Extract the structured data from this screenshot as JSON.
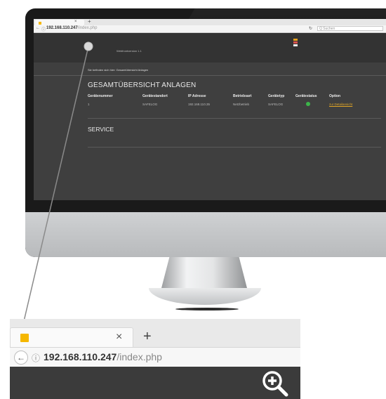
{
  "browser": {
    "url_host": "192.168.110.247",
    "url_path": "/index.php",
    "search_placeholder": "Q  Suchen",
    "tab_close": "×",
    "new_tab": "+",
    "back": "←",
    "info": "ⓘ",
    "reload": "↻"
  },
  "app": {
    "version": "Webfrontversion 1.1",
    "breadcrumb": "Sie befinden sich hier: Gesamtübersicht Anlagen",
    "section_title": "GESAMTÜBERSICHT ANLAGEN",
    "service_title": "SERVICE",
    "logo_colors": [
      "#e8a21c",
      "#d9534f",
      "#f0f0f0"
    ]
  },
  "table": {
    "headers": [
      "Gerätenummer",
      "Gerätestandort",
      "IP Adresse",
      "Betriebsart",
      "Gerätetyp",
      "Gerätestatus",
      "Option"
    ],
    "rows": [
      {
        "nummer": "1",
        "standort": "SAFELOG",
        "ip": "192.168.110.35",
        "betriebsart": "Netzbetrieb",
        "typ": "SAFELOG",
        "status_color": "#3cb54a",
        "option": "zur Detailansicht"
      }
    ]
  },
  "zoom": {
    "icon": "zoom-in-icon"
  }
}
